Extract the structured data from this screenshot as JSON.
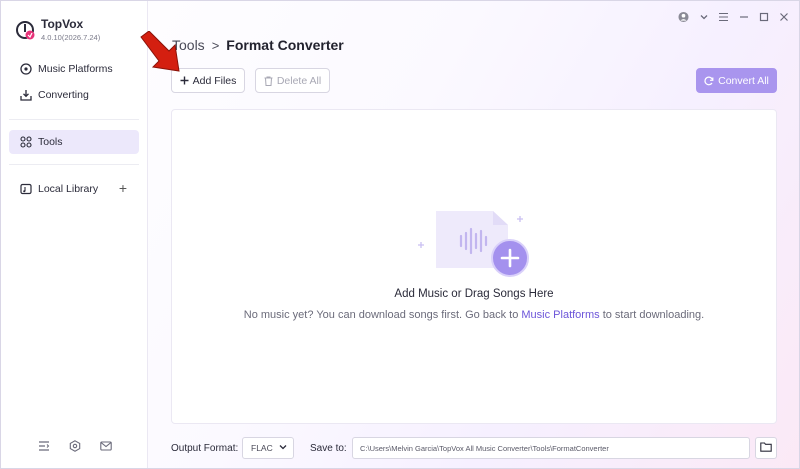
{
  "app": {
    "name": "TopVox",
    "version": "4.0.10(2026.7.24)"
  },
  "sidebar": {
    "items": [
      {
        "label": "Music Platforms",
        "icon": "music-disc-icon"
      },
      {
        "label": "Converting",
        "icon": "download-tray-icon"
      },
      {
        "label": "Tools",
        "icon": "grid-icon",
        "active": true
      },
      {
        "label": "Local Library",
        "icon": "library-icon"
      }
    ],
    "add_label": "+",
    "bottom_icons": [
      "menu-list-icon",
      "settings-hexagon-icon",
      "mail-icon"
    ]
  },
  "window_controls": [
    "user-avatar-icon",
    "chevron-down-icon",
    "hamburger-menu-icon",
    "minimize-icon",
    "maximize-icon",
    "close-icon"
  ],
  "header": {
    "breadcrumb_root": "Tools",
    "breadcrumb_sep": ">",
    "breadcrumb_current": "Format Converter"
  },
  "toolbar": {
    "add_files_label": "Add Files",
    "delete_all_label": "Delete All",
    "convert_all_label": "Convert All"
  },
  "dropzone": {
    "title": "Add Music or Drag Songs Here",
    "hint_before": "No music yet? You can download songs first. Go back to ",
    "hint_link": "Music Platforms",
    "hint_after": " to start downloading."
  },
  "footer": {
    "output_format_label": "Output Format:",
    "output_format_value": "FLAC",
    "save_to_label": "Save to:",
    "save_to_path": "C:\\Users\\Melvin Garcia\\TopVox All Music Converter\\Tools\\FormatConverter"
  },
  "colors": {
    "accent": "#a995ee",
    "link": "#6c55d9",
    "active_nav_bg": "#ece8fb",
    "annotation_arrow": "#d41f10"
  }
}
